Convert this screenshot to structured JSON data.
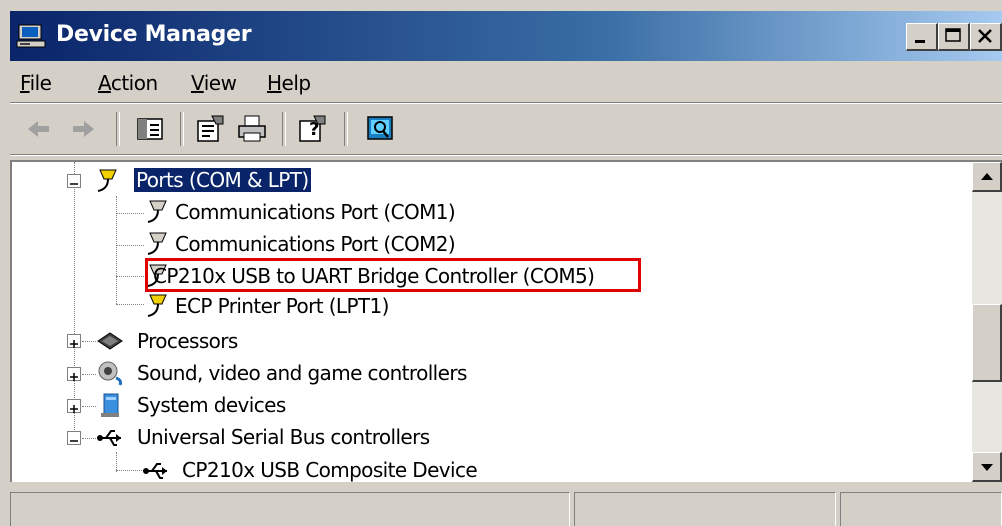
{
  "window": {
    "title": "Device Manager",
    "icon": "computer-icon"
  },
  "menu": {
    "items": [
      {
        "label": "File",
        "accel": "F"
      },
      {
        "label": "Action",
        "accel": "A"
      },
      {
        "label": "View",
        "accel": "V"
      },
      {
        "label": "Help",
        "accel": "H"
      }
    ]
  },
  "toolbar": {
    "buttons": [
      "back-arrow-icon",
      "forward-arrow-icon",
      "show-hide-console-tree-icon",
      "properties-icon",
      "print-icon",
      "help-icon",
      "scan-hardware-changes-icon"
    ]
  },
  "tree": {
    "ports_category": "Ports (COM & LPT)",
    "ports": [
      "Communications Port (COM1)",
      "Communications Port (COM2)",
      "CP210x USB to UART Bridge Controller (COM5)",
      "ECP Printer Port (LPT1)"
    ],
    "processors": "Processors",
    "sound": "Sound, video and game controllers",
    "system": "System devices",
    "usb_category": "Universal Serial Bus controllers",
    "usb_devices": [
      "CP210x USB Composite Device"
    ]
  },
  "highlight": {
    "color": "#e00000",
    "target": "CP210x USB to UART Bridge Controller (COM5)"
  },
  "colors": {
    "title_bar_start": "#0a246a",
    "title_bar_end": "#a6caf0",
    "selection": "#0a246a",
    "chrome": "#d4d0c8"
  },
  "statusbar": {
    "panels": [
      "",
      "",
      ""
    ]
  }
}
